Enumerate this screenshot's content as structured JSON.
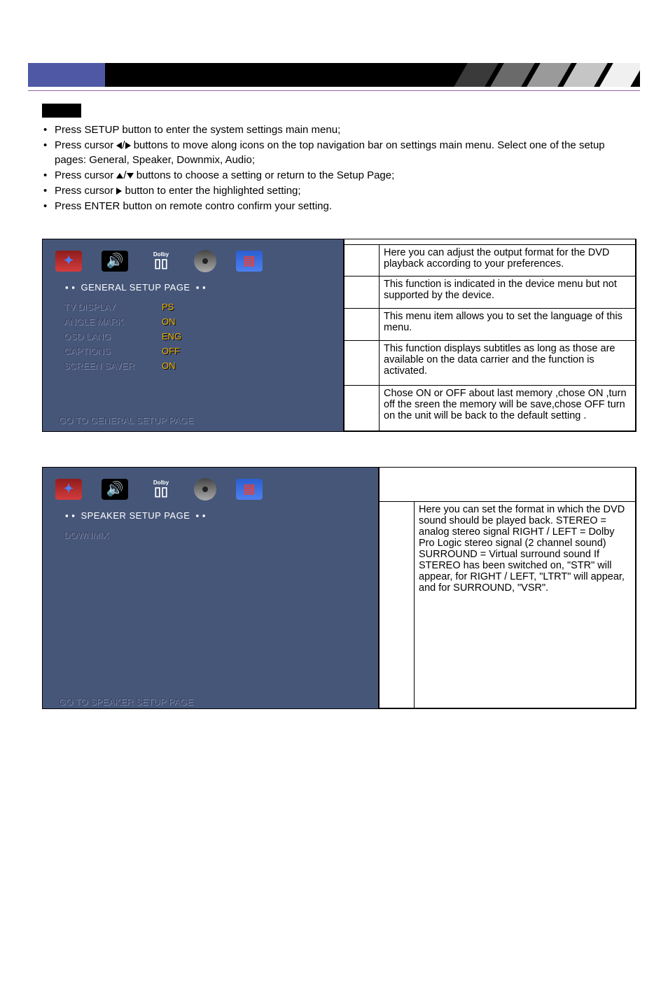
{
  "intro": {
    "b1": "Press SETUP button to enter the system settings main menu;",
    "b2a": "Press cursor ",
    "b2b": " buttons to move along icons on the top navigation bar on settings main menu. Select one of the setup pages: General, Speaker, Downmix, Audio;",
    "b3a": "Press cursor ",
    "b3b": " buttons to choose a setting or return to the Setup Page;",
    "b4a": "Press cursor ",
    "b4b": " button to enter the highlighted setting;",
    "b5": "Press ENTER button on remote contro confirm your setting."
  },
  "general": {
    "title": "GENERAL SETUP PAGE",
    "rows": [
      {
        "label": "TV DISPLAY",
        "value": "PS"
      },
      {
        "label": "ANGLE MARK",
        "value": "ON"
      },
      {
        "label": "OSD LANG",
        "value": "ENG"
      },
      {
        "label": "CAPTIONS",
        "value": "OFF"
      },
      {
        "label": "SCREEN SAVER",
        "value": "ON"
      }
    ],
    "footer": "GO TO GENERAL  SETUP PAGE",
    "desc": [
      "Here you can adjust the output format for the DVD playback according to your preferences.",
      "This function is indicated in the device menu but not supported by the device.",
      "This menu item allows you to set the language of this menu.",
      "This function displays subtitles as long as those are available on the data carrier and the function is activated.",
      "Chose ON or OFF about last memory ,chose ON ,turn off the sreen the memory will be save,chose OFF turn on the unit will be back to the default setting ."
    ]
  },
  "speaker": {
    "title": "SPEAKER SETUP PAGE",
    "row_label": "DOWNMIX",
    "footer": "GO TO SPEAKER  SETUP PAGE",
    "desc": "Here you can set the format in which the DVD sound should be played back. STEREO = analog stereo signal RIGHT / LEFT = Dolby Pro Logic stereo signal (2 channel sound) SURROUND = Virtual surround sound If STEREO has been switched on, \"STR\" will appear, for RIGHT / LEFT, \"LTRT\" will appear, and for SURROUND, \"VSR\"."
  },
  "nav": {
    "dolby": "Dolby"
  }
}
